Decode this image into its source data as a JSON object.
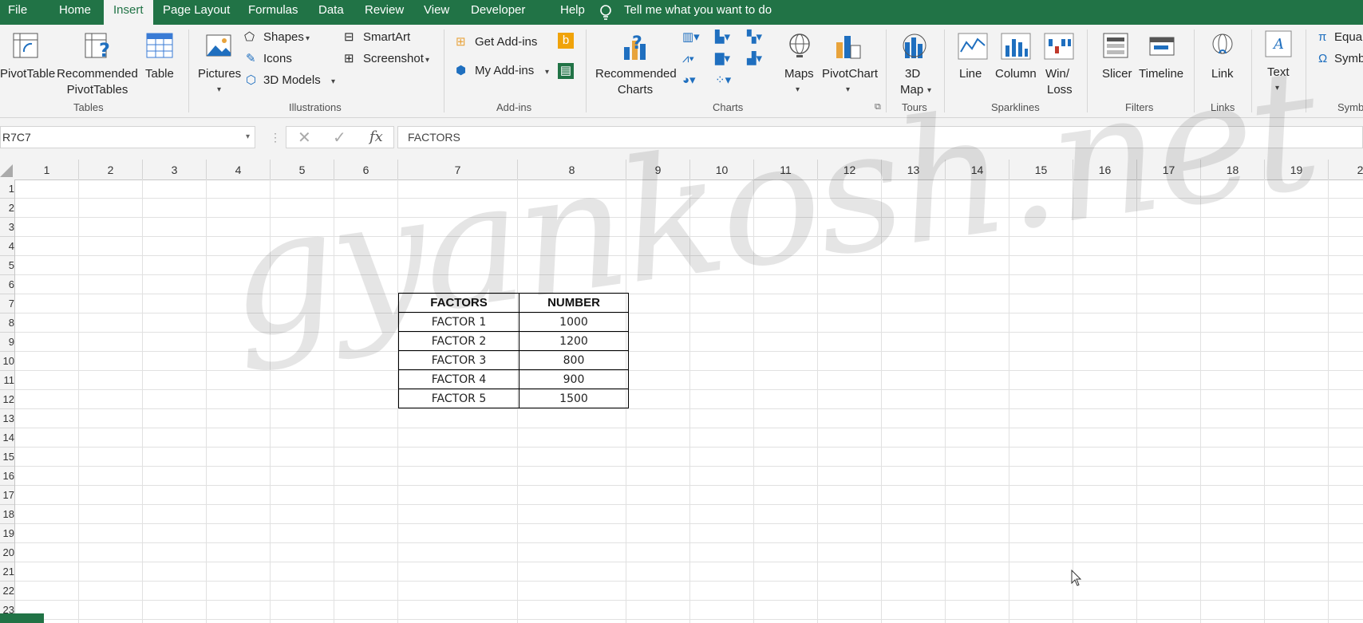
{
  "menu": {
    "items": [
      "File",
      "Home",
      "Insert",
      "Page Layout",
      "Formulas",
      "Data",
      "Review",
      "View",
      "Developer",
      "Help"
    ],
    "active": "Insert",
    "tell_me": "Tell me what you want to do"
  },
  "ribbon": {
    "tables": {
      "pivot_table": "PivotTable",
      "recommended_1": "Recommended",
      "recommended_2": "PivotTables",
      "table": "Table",
      "label": "Tables"
    },
    "illustrations": {
      "pictures": "Pictures",
      "shapes": "Shapes",
      "icons": "Icons",
      "models": "3D Models",
      "smartart": "SmartArt",
      "screenshot": "Screenshot",
      "label": "Illustrations"
    },
    "addins": {
      "get": "Get Add-ins",
      "my": "My Add-ins",
      "label": "Add-ins"
    },
    "charts": {
      "recommended_1": "Recommended",
      "recommended_2": "Charts",
      "maps": "Maps",
      "pivot_chart": "PivotChart",
      "label": "Charts"
    },
    "tours": {
      "map_1": "3D",
      "map_2": "Map",
      "label": "Tours"
    },
    "sparklines": {
      "line": "Line",
      "column": "Column",
      "winloss_1": "Win/",
      "winloss_2": "Loss",
      "label": "Sparklines"
    },
    "filters": {
      "slicer": "Slicer",
      "timeline": "Timeline",
      "label": "Filters"
    },
    "links": {
      "link": "Link",
      "label": "Links"
    },
    "text": {
      "text": "Text"
    },
    "symbols": {
      "equation": "Equa",
      "symbol": "Symb",
      "label": "Symb"
    }
  },
  "formula_bar": {
    "name_box": "R7C7",
    "formula": "FACTORS"
  },
  "columns": [
    "1",
    "2",
    "3",
    "4",
    "5",
    "6",
    "7",
    "8",
    "9",
    "10",
    "11",
    "12",
    "13",
    "14",
    "15",
    "16",
    "17",
    "18",
    "19",
    "2"
  ],
  "rows": [
    "1",
    "2",
    "3",
    "4",
    "5",
    "6",
    "7",
    "8",
    "9",
    "10",
    "11",
    "12",
    "13",
    "14",
    "15",
    "16",
    "17",
    "18",
    "19",
    "20",
    "21",
    "22",
    "23"
  ],
  "table": {
    "headers": [
      "FACTORS",
      "NUMBER"
    ],
    "rows": [
      [
        "FACTOR 1",
        "1000"
      ],
      [
        "FACTOR 2",
        "1200"
      ],
      [
        "FACTOR 3",
        "800"
      ],
      [
        "FACTOR 4",
        "900"
      ],
      [
        "FACTOR 5",
        "1500"
      ]
    ]
  },
  "watermark": "gyankosh.net",
  "colors": {
    "accent": "#217346",
    "ribbon_bg": "#f3f3f3",
    "grid_line": "#e1e1e1"
  }
}
